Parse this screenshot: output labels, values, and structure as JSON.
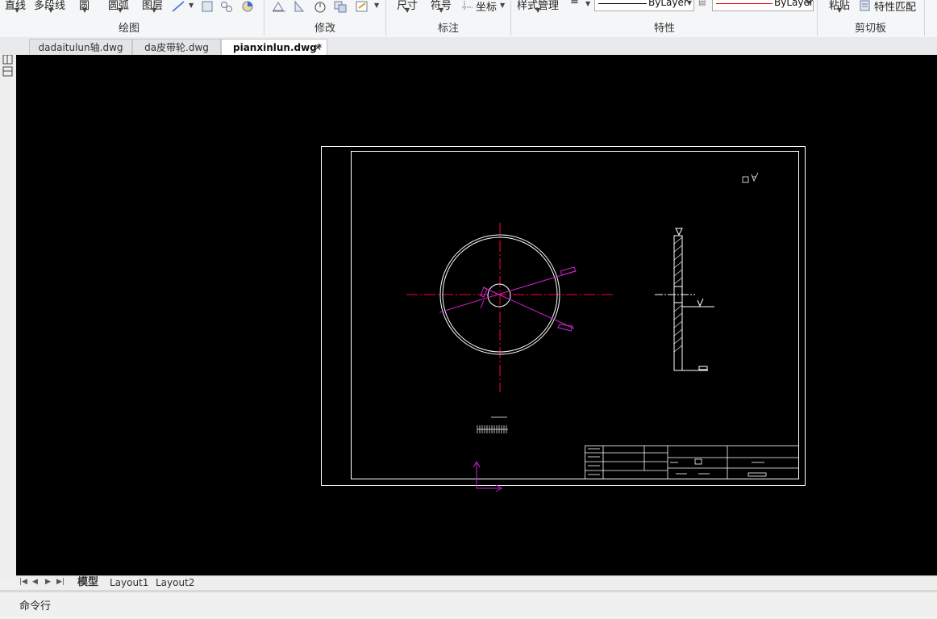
{
  "ribbon": {
    "groups": [
      {
        "label": "绘图"
      },
      {
        "label": "修改"
      },
      {
        "label": "标注"
      },
      {
        "label": "特性"
      },
      {
        "label": "剪切板"
      }
    ],
    "draw_items": [
      "直线",
      "多段线",
      "圆",
      "圆弧",
      "图层"
    ],
    "annot_items": [
      "尺寸",
      "符号",
      "坐标"
    ],
    "layer_mgr": "样式管理",
    "linetype_value": "ByLayer",
    "color_value": "ByLayer",
    "clipboard_item": "粘贴",
    "match_props": "特性匹配"
  },
  "file_tabs": [
    {
      "label": "dadaitulun轴.dwg",
      "active": false
    },
    {
      "label": "da皮带轮.dwg",
      "active": false
    },
    {
      "label": "pianxinlun.dwg*",
      "active": true
    }
  ],
  "layout_tabs": [
    {
      "label": "模型",
      "active": true
    },
    {
      "label": "Layout1",
      "active": false
    },
    {
      "label": "Layout2",
      "active": false
    }
  ],
  "command": {
    "label": "命令行"
  },
  "colors": {
    "canvas": "#000000",
    "center_line": "#ff0033",
    "dimension": "#cc22cc",
    "geometry": "#ffffff"
  },
  "icons": [
    "line-icon",
    "rectangle-icon",
    "hatch-icon",
    "region-icon",
    "stretch-icon",
    "mirror-icon",
    "rotate-icon",
    "copy-icon",
    "properties-icon",
    "coordinate-icon",
    "match-properties-icon",
    "close-icon"
  ]
}
